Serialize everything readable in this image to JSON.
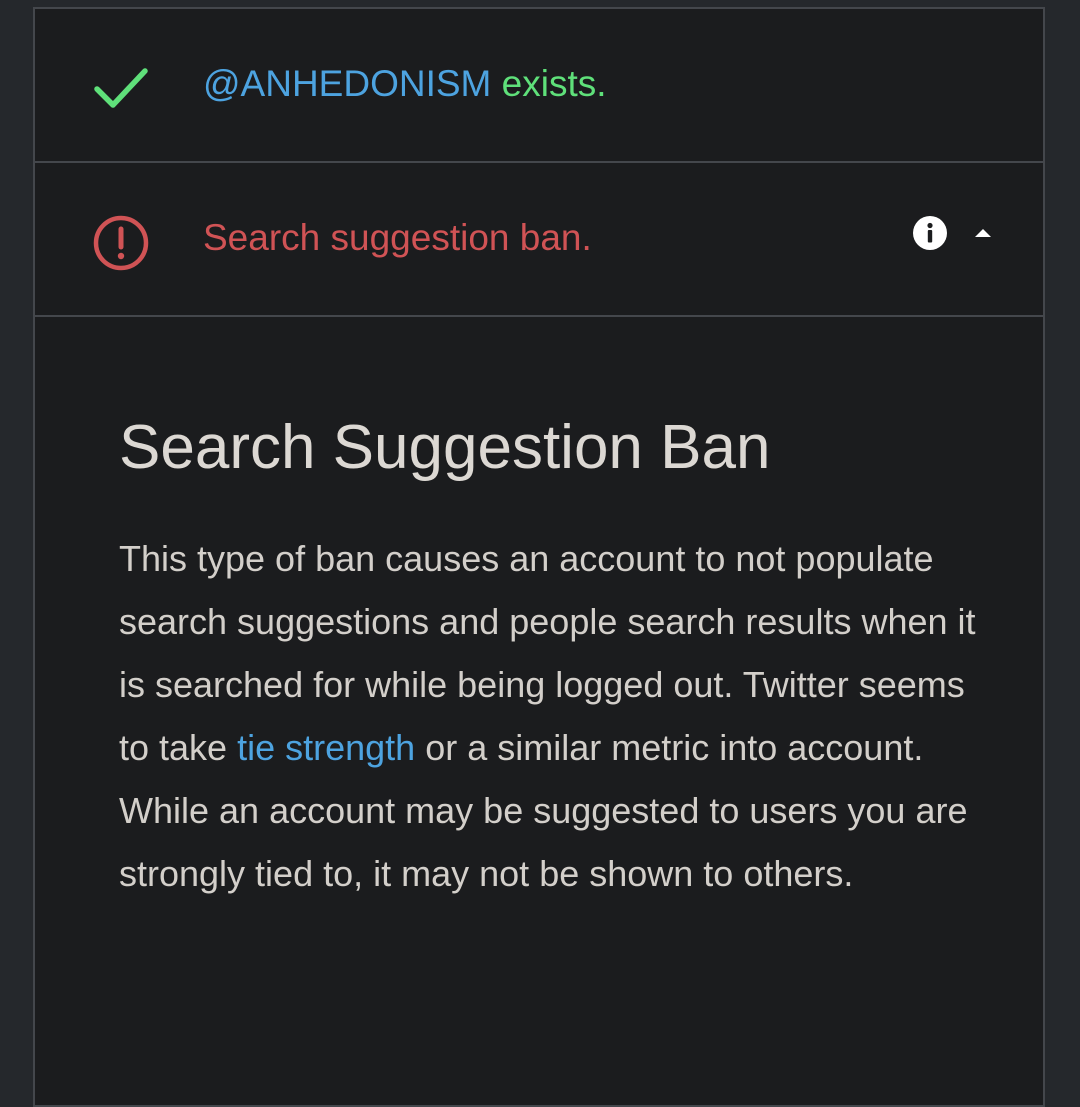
{
  "results": {
    "exists_row": {
      "icon": "check-icon",
      "handle": "@ANHEDONISM",
      "status": "exists.",
      "status_color": "#5fe07a",
      "handle_color": "#4da3e0"
    },
    "ban_row": {
      "icon": "alert-circle-icon",
      "label": "Search suggestion ban.",
      "color": "#d05355",
      "info_icon": "info-icon",
      "toggle_icon": "caret-up-icon"
    }
  },
  "detail": {
    "title": "Search Suggestion Ban",
    "body_before_link": "This type of ban causes an account to not populate search suggestions and people search results when it is searched for while being logged out. Twitter seems to take ",
    "link_text": "tie strength",
    "body_after_link": " or a similar metric into account. While an account may be suggested to users you are strongly tied to, it may not be shown to others.",
    "link_color": "#4da3e0"
  }
}
